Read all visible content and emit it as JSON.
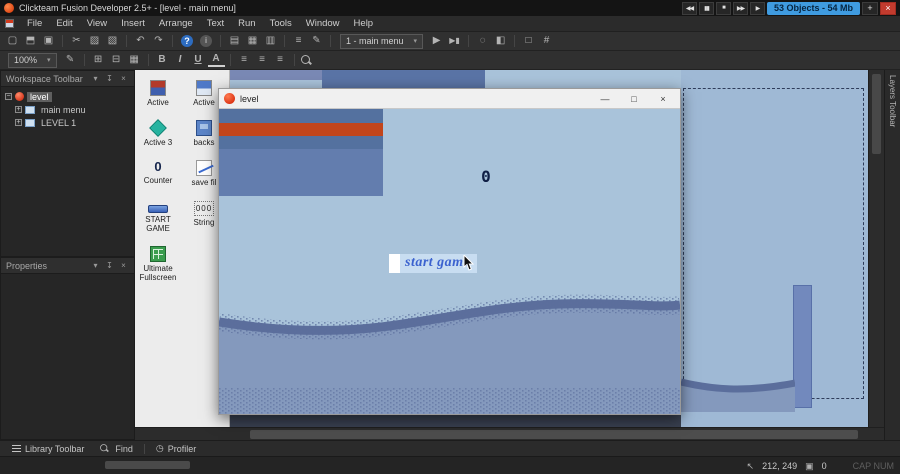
{
  "titlebar": {
    "title": "Clickteam Fusion Developer 2.5+ - [level - main menu]",
    "objects_badge": "53 Objects - 54 Mb"
  },
  "menubar": {
    "items": [
      "File",
      "Edit",
      "View",
      "Insert",
      "Arrange",
      "Text",
      "Run",
      "Tools",
      "Window",
      "Help"
    ]
  },
  "toolbars": {
    "frame_selector": "1 - main menu",
    "zoom_level": "100%"
  },
  "workspace_panel": {
    "title": "Workspace Toolbar",
    "tree": [
      {
        "label": "level"
      },
      {
        "label": "main menu"
      },
      {
        "label": "LEVEL 1"
      }
    ]
  },
  "properties_panel": {
    "title": "Properties"
  },
  "objects_panel": {
    "items": [
      {
        "label": "Active"
      },
      {
        "label": "Active"
      },
      {
        "label": "Active 3"
      },
      {
        "label": "backs"
      },
      {
        "label": "Counter",
        "glyph": "0"
      },
      {
        "label": "save fil"
      },
      {
        "label": "START GAME"
      },
      {
        "label": "String",
        "glyph": "000"
      },
      {
        "label": "Ultimate Fullscreen"
      }
    ]
  },
  "preview_window": {
    "title": "level",
    "counter_value": "0",
    "start_button_label": "start game"
  },
  "layers_toolbar": {
    "title": "Layers Toolbar"
  },
  "bottom_tabs": {
    "library": "Library Toolbar",
    "find": "Find",
    "profiler": "Profiler"
  },
  "statusbar": {
    "coordinates": "212, 249",
    "object_count": "0",
    "lock_keys": "CAP NUM"
  },
  "colors": {
    "badge_blue": "#3f9be0",
    "platform_blue": "#54719f",
    "stripe_orange": "#c2451b",
    "sky_blue": "#a9c3da",
    "ground_blue": "#8499bd",
    "ground_edge": "#5b6e9c"
  },
  "icons": {
    "restart": "◀◀",
    "pause": "▮▮",
    "stop": "■",
    "skip": "▶▶",
    "play": "▶",
    "plus": "+",
    "close": "×",
    "dropdown": "▾",
    "new": "▢",
    "open": "⬒",
    "save": "▣",
    "cut": "✂",
    "copy": "▨",
    "paste": "▧",
    "undo": "↶",
    "redo": "↷",
    "help": "?",
    "info": "i",
    "storyboard": "▤",
    "frame_editor": "▦",
    "event_editor": "▥",
    "event_list": "≡",
    "picture_editor": "✎",
    "play_frame": "▶",
    "next_frame": "▶▮",
    "multi_select": "◌",
    "color_select": "◧",
    "grid_options": "□",
    "anchor": "#",
    "pen": "✎",
    "grid_setup": "⊞",
    "grid_snap": "⊟",
    "grid_show": "▦",
    "bold": "B",
    "italic": "I",
    "underline": "U",
    "font_color": "A",
    "align_left": "≡",
    "align_center": "≡",
    "align_right": "≡",
    "minimize": "—",
    "maximize": "□",
    "pin": "↧",
    "options": "▾",
    "expand": "+",
    "collapse": "−",
    "clock": "◷",
    "cursor_pos": "↖",
    "obj_count": "▣"
  }
}
